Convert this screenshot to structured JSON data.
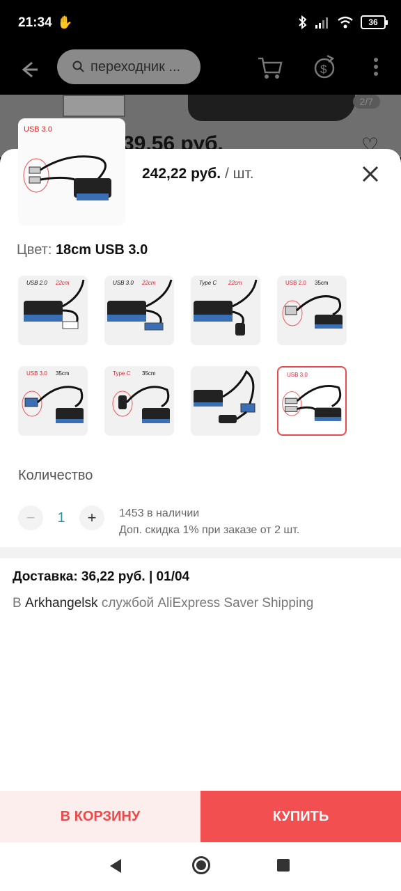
{
  "status_bar": {
    "time": "21:34",
    "battery": "36"
  },
  "header": {
    "search_text": "переходник ...",
    "pager": "2/7",
    "bg_price": "39,56 руб."
  },
  "sheet": {
    "price": "242,22 руб.",
    "price_unit": "/ шт.",
    "color_label": "Цвет:",
    "color_value": "18cm USB 3.0",
    "variants": [
      {
        "label": "USB 2.0",
        "length": "22cm"
      },
      {
        "label": "USB 3.0",
        "length": "22cm"
      },
      {
        "label": "Type C",
        "length": "22cm"
      },
      {
        "label": "USB 2.0",
        "length": "35cm"
      },
      {
        "label": "USB 3.0",
        "length": "35cm"
      },
      {
        "label": "Type C",
        "length": "35cm"
      },
      {
        "label": "",
        "length": ""
      },
      {
        "label": "USB 3.0",
        "length": "",
        "selected": true
      }
    ],
    "quantity_title": "Количество",
    "quantity_value": "1",
    "stock_text": "1453 в наличии",
    "discount_text": "Доп. скидка 1% при заказе от 2 шт.",
    "shipping_title": "Доставка: 36,22 руб. | 01/04",
    "shipping_prefix": "В",
    "shipping_city": "Arkhangelsk",
    "shipping_suffix": "службой AliExpress Saver Shipping",
    "main_thumb_label": "USB 3.0"
  },
  "actions": {
    "cart_label": "В КОРЗИНУ",
    "buy_label": "КУПИТЬ"
  },
  "colors": {
    "accent": "#f25050",
    "accent_light": "#fdeeee",
    "qty": "#2a8fa8"
  }
}
